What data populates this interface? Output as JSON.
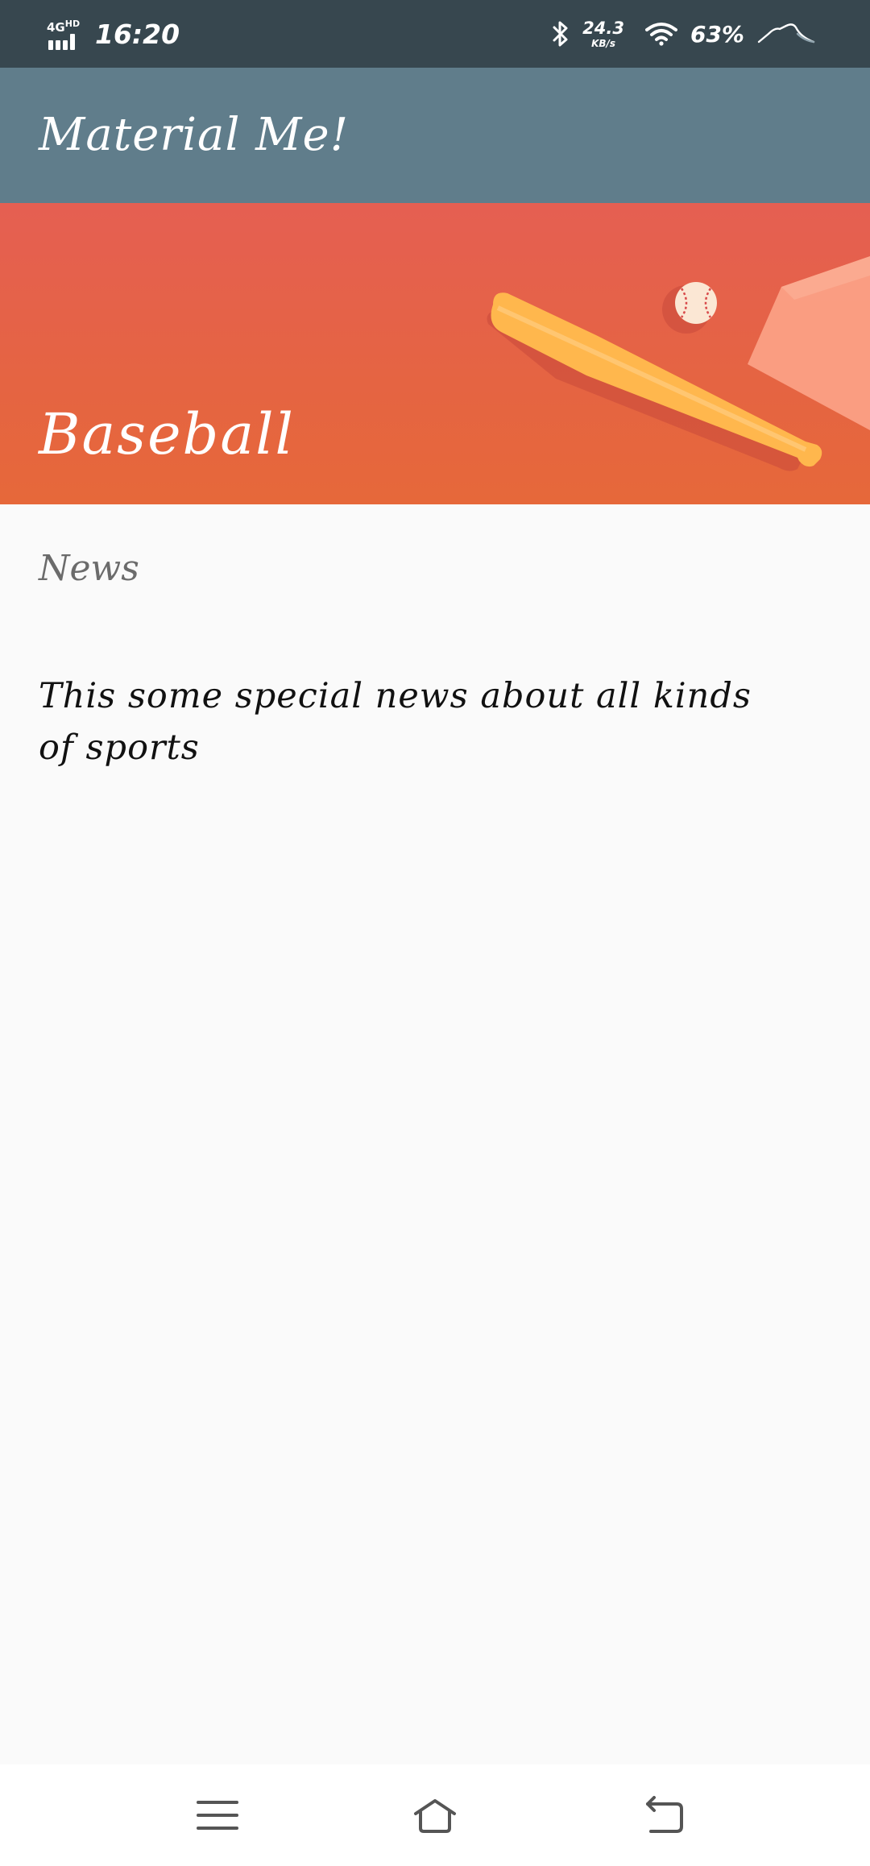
{
  "status_bar": {
    "network": "4G",
    "network_sup": "HD",
    "time": "16:20",
    "speed_value": "24.3",
    "speed_unit": "KB/s",
    "battery": "63%"
  },
  "app_bar": {
    "title": "Material Me!"
  },
  "banner": {
    "title": "Baseball"
  },
  "content": {
    "subtitle": "News",
    "body": "This some special news about all kinds of sports"
  },
  "colors": {
    "status_bar": "#37474f",
    "app_bar": "#607d8b",
    "banner": "#e5613f",
    "background": "#fafafa"
  },
  "nav_bar": {
    "icons": [
      "menu-icon",
      "home-icon",
      "back-icon"
    ]
  }
}
